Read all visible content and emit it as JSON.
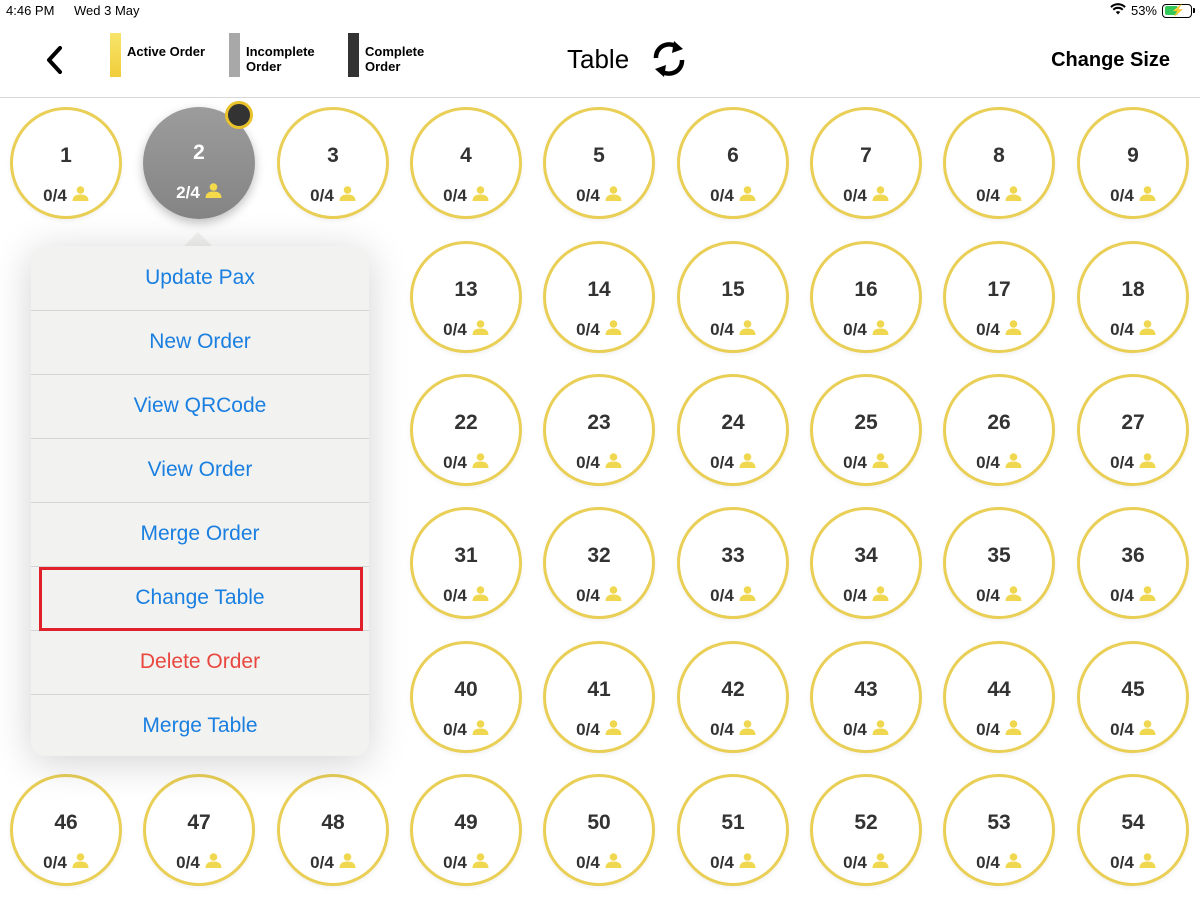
{
  "status_bar": {
    "time": "4:46 PM",
    "date": "Wed 3 May",
    "battery": "53%",
    "battery_level": 0.53
  },
  "header": {
    "title": "Table",
    "change_size_label": "Change Size",
    "legend": [
      {
        "label": "Active Order",
        "color": "#f4d94a"
      },
      {
        "label": "Incomplete Order",
        "color": "#a8a8a8"
      },
      {
        "label": "Complete Order",
        "color": "#333333"
      }
    ]
  },
  "colors": {
    "table_border": "#e9cf56",
    "pax_icon": "#efd850",
    "menu_text": "#1a7fe0",
    "destructive_text": "#e8483f",
    "highlight": "#e0202a"
  },
  "tables": [
    {
      "num": "1",
      "pax": "0/4"
    },
    {
      "num": "2",
      "pax": "2/4",
      "selected": true
    },
    {
      "num": "3",
      "pax": "0/4"
    },
    {
      "num": "4",
      "pax": "0/4"
    },
    {
      "num": "5",
      "pax": "0/4"
    },
    {
      "num": "6",
      "pax": "0/4"
    },
    {
      "num": "7",
      "pax": "0/4"
    },
    {
      "num": "8",
      "pax": "0/4"
    },
    {
      "num": "9",
      "pax": "0/4"
    },
    {
      "num": "13",
      "pax": "0/4"
    },
    {
      "num": "14",
      "pax": "0/4"
    },
    {
      "num": "15",
      "pax": "0/4"
    },
    {
      "num": "16",
      "pax": "0/4"
    },
    {
      "num": "17",
      "pax": "0/4"
    },
    {
      "num": "18",
      "pax": "0/4"
    },
    {
      "num": "22",
      "pax": "0/4"
    },
    {
      "num": "23",
      "pax": "0/4"
    },
    {
      "num": "24",
      "pax": "0/4"
    },
    {
      "num": "25",
      "pax": "0/4"
    },
    {
      "num": "26",
      "pax": "0/4"
    },
    {
      "num": "27",
      "pax": "0/4"
    },
    {
      "num": "31",
      "pax": "0/4"
    },
    {
      "num": "32",
      "pax": "0/4"
    },
    {
      "num": "33",
      "pax": "0/4"
    },
    {
      "num": "34",
      "pax": "0/4"
    },
    {
      "num": "35",
      "pax": "0/4"
    },
    {
      "num": "36",
      "pax": "0/4"
    },
    {
      "num": "40",
      "pax": "0/4"
    },
    {
      "num": "41",
      "pax": "0/4"
    },
    {
      "num": "42",
      "pax": "0/4"
    },
    {
      "num": "43",
      "pax": "0/4"
    },
    {
      "num": "44",
      "pax": "0/4"
    },
    {
      "num": "45",
      "pax": "0/4"
    },
    {
      "num": "46",
      "pax": "0/4"
    },
    {
      "num": "47",
      "pax": "0/4"
    },
    {
      "num": "48",
      "pax": "0/4"
    },
    {
      "num": "49",
      "pax": "0/4"
    },
    {
      "num": "50",
      "pax": "0/4"
    },
    {
      "num": "51",
      "pax": "0/4"
    },
    {
      "num": "52",
      "pax": "0/4"
    },
    {
      "num": "53",
      "pax": "0/4"
    },
    {
      "num": "54",
      "pax": "0/4"
    }
  ],
  "popover_menu": [
    {
      "label": "Update Pax"
    },
    {
      "label": "New Order"
    },
    {
      "label": "View QRCode"
    },
    {
      "label": "View Order"
    },
    {
      "label": "Merge Order"
    },
    {
      "label": "Change Table",
      "highlighted": true
    },
    {
      "label": "Delete Order",
      "destructive": true
    },
    {
      "label": "Merge Table"
    }
  ]
}
